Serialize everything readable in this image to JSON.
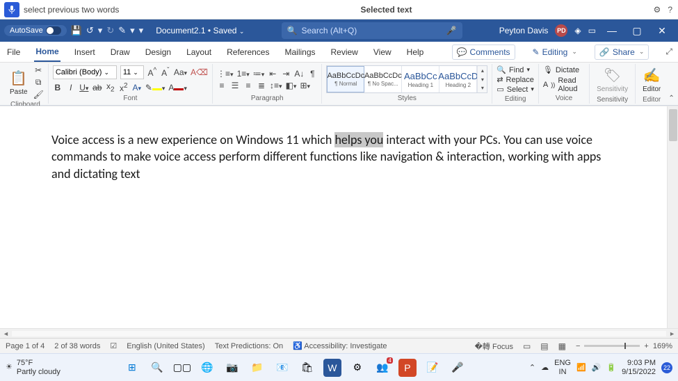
{
  "voicebar": {
    "command": "select previous two words",
    "center": "Selected text"
  },
  "titlebar": {
    "autosave": "AutoSave",
    "doc": "Document2.1 • Saved",
    "search_placeholder": "Search (Alt+Q)",
    "user": "Peyton Davis",
    "initials": "PD"
  },
  "tabs": {
    "file": "File",
    "home": "Home",
    "insert": "Insert",
    "draw": "Draw",
    "design": "Design",
    "layout": "Layout",
    "references": "References",
    "mailings": "Mailings",
    "review": "Review",
    "view": "View",
    "help": "Help",
    "comments": "Comments",
    "editing": "Editing",
    "share": "Share"
  },
  "ribbon": {
    "clipboard": {
      "paste": "Paste",
      "label": "Clipboard"
    },
    "font": {
      "name": "Calibri (Body)",
      "size": "11",
      "label": "Font"
    },
    "paragraph": {
      "label": "Paragraph"
    },
    "styles": {
      "label": "Styles",
      "items": [
        {
          "sample": "AaBbCcDc",
          "lbl": "¶ Normal"
        },
        {
          "sample": "AaBbCcDc",
          "lbl": "¶ No Spac..."
        },
        {
          "sample": "AaBbCc",
          "lbl": "Heading 1"
        },
        {
          "sample": "AaBbCcD",
          "lbl": "Heading 2"
        }
      ]
    },
    "editing": {
      "find": "Find",
      "replace": "Replace",
      "select": "Select",
      "label": "Editing"
    },
    "voice": {
      "dictate": "Dictate",
      "read": "Read Aloud",
      "label": "Voice"
    },
    "sensitivity": {
      "btn": "Sensitivity",
      "label": "Sensitivity"
    },
    "editor": {
      "btn": "Editor",
      "label": "Editor"
    }
  },
  "doc": {
    "pre": "Voice access is a new experience on Windows 11 which ",
    "sel": "helps you",
    "post": " interact with your PCs. You can use voice commands to make voice access perform different functions like navigation & interaction, working with apps and dictating text"
  },
  "status": {
    "page": "Page 1 of 4",
    "words": "2 of 38 words",
    "lang": "English (United States)",
    "pred": "Text Predictions: On",
    "acc": "Accessibility: Investigate",
    "focus": "Focus",
    "zoom": "169%"
  },
  "taskbar": {
    "temp": "75°F",
    "cond": "Partly cloudy",
    "lang1": "ENG",
    "lang2": "IN",
    "time": "9:03 PM",
    "date": "9/15/2022",
    "badge": "22"
  }
}
